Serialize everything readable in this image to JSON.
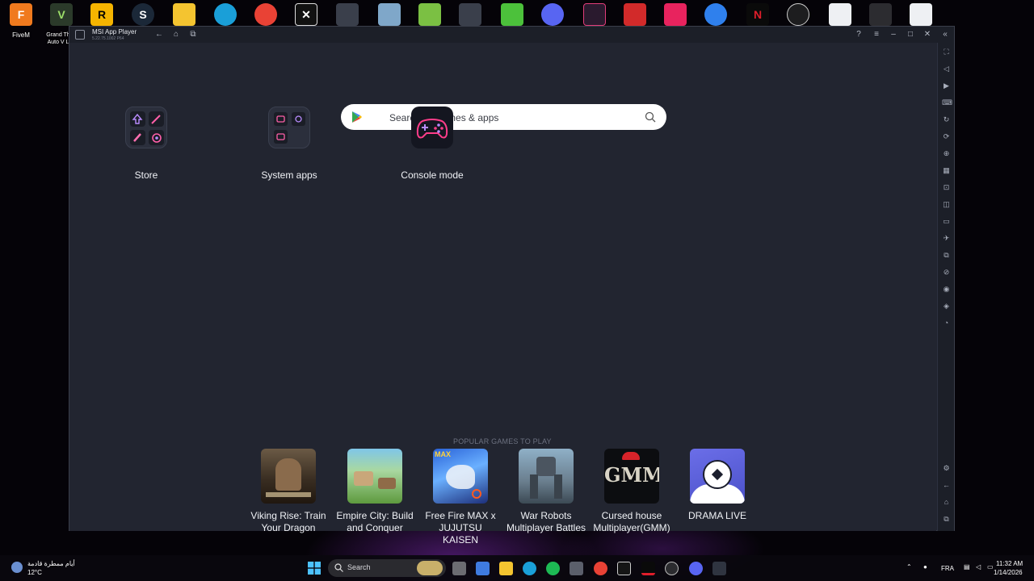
{
  "desktop": {
    "icons": [
      {
        "label": "FiveM"
      },
      {
        "label": "Grand Th\nAuto V L"
      }
    ]
  },
  "window": {
    "title": "MSI App Player",
    "version": "5.22.75.1002 P64"
  },
  "search": {
    "placeholder": "Search for games & apps"
  },
  "home_apps": [
    {
      "label": "Store"
    },
    {
      "label": "System apps"
    },
    {
      "label": "Console mode"
    }
  ],
  "popular": {
    "title": "POPULAR GAMES TO PLAY",
    "games": [
      {
        "name": "Viking Rise: Train Your Dragon"
      },
      {
        "name": "Empire City: Build and Conquer"
      },
      {
        "name": "Free Fire MAX x JUJUTSU KAISEN"
      },
      {
        "name": "War Robots Multiplayer Battles"
      },
      {
        "name": "Cursed house Multiplayer(GMM)"
      },
      {
        "name": "DRAMA LIVE"
      }
    ]
  },
  "taskbar": {
    "search_label": "Search",
    "weather": {
      "text": "أيام ممطرة قادمة",
      "temp": "12°C"
    },
    "language": "FRA",
    "time": "11:32 AM",
    "date": "1/14/2026"
  },
  "colors": {
    "window_bg": "#222530",
    "titlebar_bg": "#1c1f28",
    "accent_pink": "#ff3d8a"
  }
}
